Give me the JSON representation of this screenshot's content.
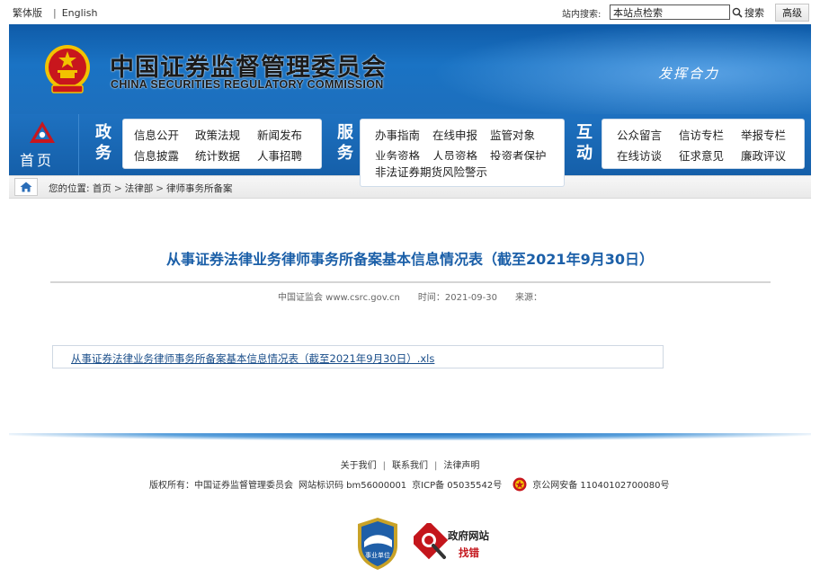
{
  "topbar": {
    "traditional": "繁体版",
    "separator": "|",
    "english": "English",
    "search_label": "站内搜索:",
    "search_value": "本站点检索",
    "search_button": "搜索",
    "advanced_button": "高级"
  },
  "banner": {
    "title_cn": "中国证券监督管理委员会",
    "title_en": "CHINA SECURITIES REGULATORY COMMISSION",
    "slogan": "发挥合力"
  },
  "nav": {
    "home": "首页",
    "group1": {
      "label1": "政",
      "label2": "务",
      "items": [
        "信息公开",
        "政策法规",
        "新闻发布",
        "信息披露",
        "统计数据",
        "人事招聘"
      ]
    },
    "group2": {
      "label1": "服",
      "label2": "务",
      "items": [
        "办事指南",
        "在线申报",
        "监管对象",
        "业务资格",
        "人员资格",
        "投资者保护",
        "非法证券期货风险警示"
      ]
    },
    "group3": {
      "label1": "互",
      "label2": "动",
      "items": [
        "公众留言",
        "信访专栏",
        "举报专栏",
        "在线访谈",
        "征求意见",
        "廉政评议"
      ]
    }
  },
  "breadcrumb": {
    "prefix": "您的位置:",
    "items": [
      "首页",
      "法律部",
      "律师事务所备案"
    ],
    "separator": ">"
  },
  "article": {
    "title": "从事证券法律业务律师事务所备案基本信息情况表（截至2021年9月30日）",
    "source": "中国证监会 www.csrc.gov.cn",
    "time": "时间：2021-09-30",
    "from": "来源：",
    "attachment": "从事证券法律业务律师事务所备案基本信息情况表（截至2021年9月30日）.xls"
  },
  "footer": {
    "links": [
      "关于我们",
      "联系我们",
      "法律声明"
    ],
    "link_sep": "|",
    "copyright": "版权所有：中国证券监督管理委员会",
    "site_id": "网站标识码 bm56000001",
    "icp": "京ICP备 05035542号",
    "police": "京公网安备 11040102700080号",
    "badge1": "事业单位",
    "badge2_line1": "政府网站",
    "badge2_line2": "找错"
  },
  "colors": {
    "banner_blue": "#1a73c4",
    "title_blue": "#1b5fa8",
    "link_blue": "#1a4e8a",
    "emblem_red": "#c8161d",
    "emblem_gold": "#f2c200"
  }
}
